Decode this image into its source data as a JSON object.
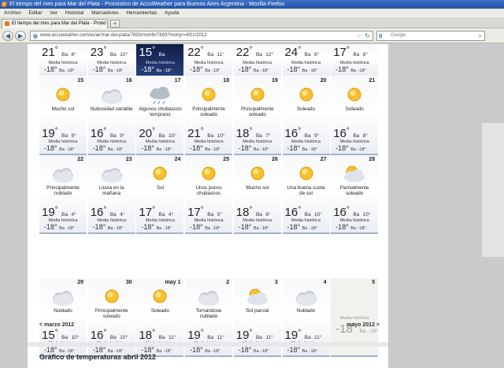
{
  "window": {
    "title": "El tiempo del mes para Mar del Plata - Pronóstico de AccuWeather para Buenos Aires Argentina - Mozilla Firefox"
  },
  "menu": [
    "Archivo",
    "Editar",
    "Ver",
    "Historial",
    "Marcadores",
    "Herramientas",
    "Ayuda"
  ],
  "tab": {
    "label": "El tiempo del mes para Mar del Plata - Pronó"
  },
  "nav": {
    "url": "www.accuweather.com/es/ar/mar-del-plata/7893/month/7893?monyr=4/01/2012",
    "search_placeholder": "Google"
  },
  "labels": {
    "ba": "Ba",
    "historic": "Media histórica",
    "prev_month": "< marzo 2012",
    "next_month": "mayo 2012 >",
    "graph_title": "Gráfico de temperaturas abril 2012"
  },
  "week1": [
    {
      "hi": "21",
      "lo": "8",
      "mh": "-18",
      "ml": "-18"
    },
    {
      "hi": "23",
      "lo": "10",
      "mh": "-18",
      "ml": "-18"
    },
    {
      "hi": "15",
      "lo": "",
      "mh": "-18",
      "ml": "-18"
    },
    {
      "hi": "22",
      "lo": "11",
      "mh": "-18",
      "ml": "-18"
    },
    {
      "hi": "22",
      "lo": "12",
      "mh": "-18",
      "ml": "-18"
    },
    {
      "hi": "24",
      "lo": "8",
      "mh": "-18",
      "ml": "-18"
    },
    {
      "hi": "17",
      "lo": "8",
      "mh": "-18",
      "ml": "-18"
    }
  ],
  "week2": [
    {
      "day": "15",
      "cond": "Mucho sol",
      "icon": "sun",
      "hi": "19",
      "lo": "9",
      "mh": "-18",
      "ml": "-18"
    },
    {
      "day": "16",
      "cond": "Nubosidad variable",
      "icon": "cloudy",
      "hi": "16",
      "lo": "9",
      "mh": "-18",
      "ml": "-18"
    },
    {
      "day": "17",
      "cond": "Algunos chubascos temprano",
      "icon": "showers",
      "hi": "20",
      "lo": "10",
      "mh": "-18",
      "ml": "-18"
    },
    {
      "day": "18",
      "cond": "Principalmente soleado",
      "icon": "sun",
      "hi": "21",
      "lo": "10",
      "mh": "-18",
      "ml": "-18"
    },
    {
      "day": "19",
      "cond": "Principalmente soleado",
      "icon": "sun",
      "hi": "18",
      "lo": "7",
      "mh": "-18",
      "ml": "-18"
    },
    {
      "day": "20",
      "cond": "Soleado",
      "icon": "sun",
      "hi": "16",
      "lo": "9",
      "mh": "-18",
      "ml": "-18"
    },
    {
      "day": "21",
      "cond": "Soleado",
      "icon": "sun",
      "hi": "16",
      "lo": "8",
      "mh": "-18",
      "ml": "-18"
    }
  ],
  "week3": [
    {
      "day": "22",
      "cond": "Principalmente nublado",
      "icon": "cloudy",
      "hi": "19",
      "lo": "4",
      "mh": "-18",
      "ml": "-18"
    },
    {
      "day": "23",
      "cond": "Lluvia en la mañana",
      "icon": "cloudy",
      "hi": "16",
      "lo": "4",
      "mh": "-18",
      "ml": "-18"
    },
    {
      "day": "24",
      "cond": "Sol",
      "icon": "sun",
      "hi": "17",
      "lo": "4",
      "mh": "-18",
      "ml": "-18"
    },
    {
      "day": "25",
      "cond": "Unos pocos chubascos",
      "icon": "sun",
      "hi": "17",
      "lo": "5",
      "mh": "-18",
      "ml": "-18"
    },
    {
      "day": "26",
      "cond": "Mucho sol",
      "icon": "sun",
      "hi": "18",
      "lo": "6",
      "mh": "-18",
      "ml": "-18"
    },
    {
      "day": "27",
      "cond": "Una buena cuota de sol",
      "icon": "sun",
      "hi": "16",
      "lo": "10",
      "mh": "-18",
      "ml": "-18"
    },
    {
      "day": "28",
      "cond": "Parcialmente soleado",
      "icon": "partly",
      "hi": "16",
      "lo": "10",
      "mh": "-18",
      "ml": "-18"
    }
  ],
  "week4": [
    {
      "day": "29",
      "cond": "Nublado",
      "icon": "cloudy",
      "hi": "15",
      "lo": "10",
      "mh": "-18",
      "ml": "-18"
    },
    {
      "day": "30",
      "cond": "Principalmente soleado",
      "icon": "sun",
      "hi": "16",
      "lo": "10",
      "mh": "-18",
      "ml": "-18"
    },
    {
      "day": "may 1",
      "cond": "Soleado",
      "icon": "sun",
      "hi": "18",
      "lo": "11",
      "mh": "-18",
      "ml": "-18"
    },
    {
      "day": "2",
      "cond": "Tornándose nublado",
      "icon": "cloudy",
      "hi": "19",
      "lo": "11",
      "mh": "-18",
      "ml": "-18"
    },
    {
      "day": "3",
      "cond": "Sol parcial",
      "icon": "partly",
      "hi": "19",
      "lo": "11",
      "mh": "-18",
      "ml": "-18"
    },
    {
      "day": "4",
      "cond": "Nublado",
      "icon": "cloudy",
      "hi": "19",
      "lo": "11",
      "mh": "-18",
      "ml": "-18"
    },
    {
      "day": "5",
      "cond": "",
      "icon": "",
      "hi": "-18",
      "lo": "-18",
      "mh": "",
      "ml": ""
    }
  ]
}
